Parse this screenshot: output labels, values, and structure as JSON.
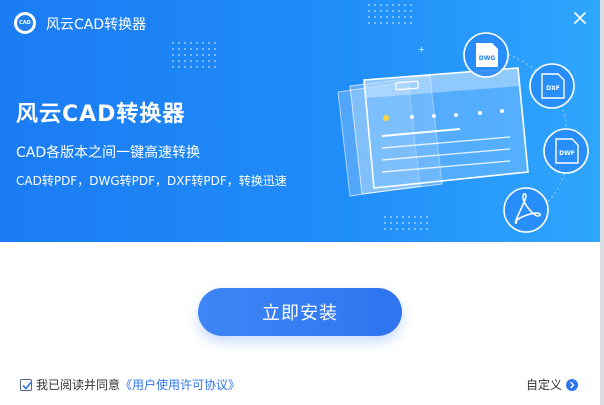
{
  "window": {
    "title": "风云CAD转换器"
  },
  "hero": {
    "title": "风云CAD转换器",
    "subtitle": "CAD各版本之间一键高速转换",
    "description": "CAD转PDF，DWG转PDF，DXF转PDF，转换迅速"
  },
  "icons": {
    "labels": [
      "DWG",
      "DXF",
      "DWF"
    ],
    "logo_text": "CAD"
  },
  "actions": {
    "install_label": "立即安装",
    "custom_label": "自定义"
  },
  "agreement": {
    "checked": true,
    "text": "我已阅读并同意",
    "link": "《用户使用许可协议》"
  },
  "colors": {
    "banner": "#1f8cf8",
    "button": "#2f74ef",
    "link": "#2f74ef"
  }
}
